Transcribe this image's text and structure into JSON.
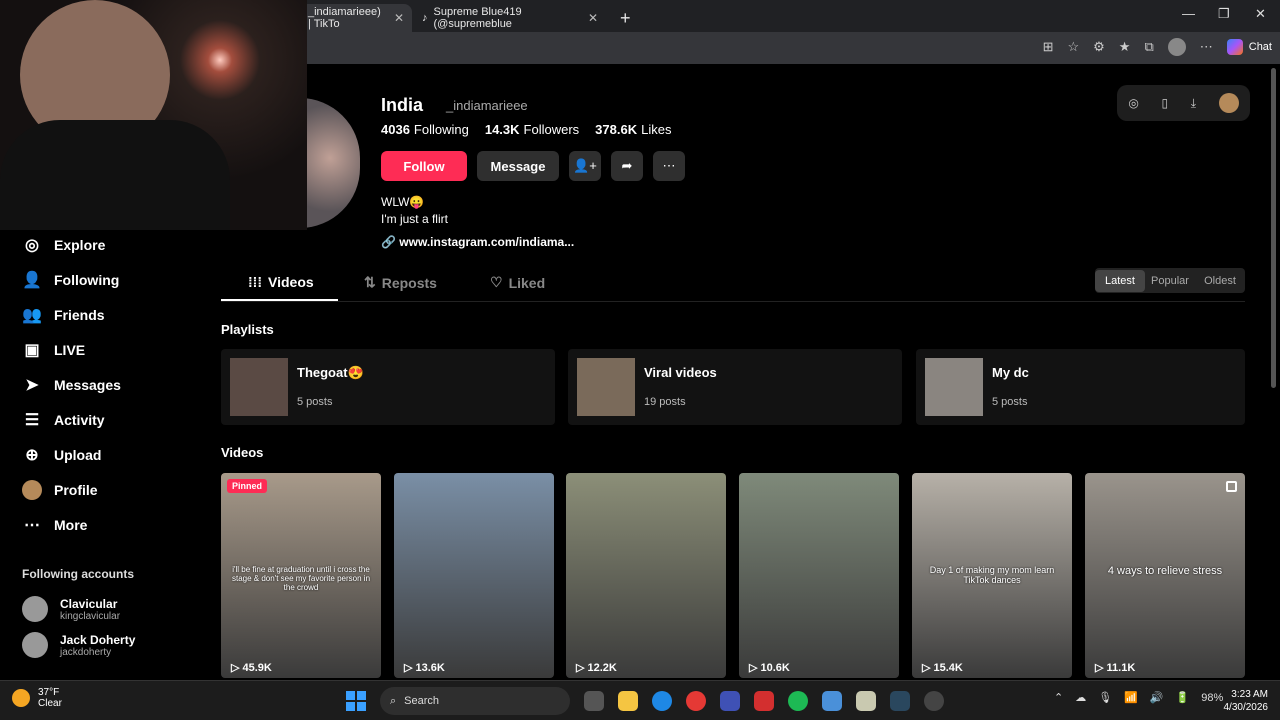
{
  "browser": {
    "tabs": [
      {
        "title": "_indiamarieee) | TikTo",
        "active": true
      },
      {
        "title": "Supreme Blue419 (@supremeblue",
        "active": false
      }
    ],
    "new_tab_icon": "plus-icon",
    "chat_label": "Chat"
  },
  "profile": {
    "name": "India",
    "handle": "_indiamarieee",
    "stats": [
      {
        "value": "4036",
        "label": "Following"
      },
      {
        "value": "14.3K",
        "label": "Followers"
      },
      {
        "value": "378.6K",
        "label": "Likes"
      }
    ],
    "follow_label": "Follow",
    "message_label": "Message",
    "bio_line1": "WLW😛",
    "bio_line2": "I'm just a flirt",
    "link": "www.instagram.com/indiama..."
  },
  "sidebar": {
    "items": [
      {
        "label": "Explore",
        "icon": "compass-icon"
      },
      {
        "label": "Following",
        "icon": "following-icon"
      },
      {
        "label": "Friends",
        "icon": "friends-icon"
      },
      {
        "label": "LIVE",
        "icon": "live-icon"
      },
      {
        "label": "Messages",
        "icon": "messages-icon"
      },
      {
        "label": "Activity",
        "icon": "activity-icon"
      },
      {
        "label": "Upload",
        "icon": "upload-icon"
      },
      {
        "label": "Profile",
        "icon": "profile-avatar"
      },
      {
        "label": "More",
        "icon": "more-icon"
      }
    ],
    "following_title": "Following accounts",
    "accounts": [
      {
        "name": "Clavicular",
        "handle": "kingclavicular"
      },
      {
        "name": "Jack Doherty",
        "handle": "jackdoherty"
      }
    ]
  },
  "content_tabs": [
    {
      "label": "Videos",
      "active": true
    },
    {
      "label": "Reposts",
      "active": false
    },
    {
      "label": "Liked",
      "active": false
    }
  ],
  "sort": [
    "Latest",
    "Popular",
    "Oldest"
  ],
  "playlists_title": "Playlists",
  "playlists": [
    {
      "title": "Thegoat😍",
      "count": "5 posts"
    },
    {
      "title": "Viral videos",
      "count": "19 posts"
    },
    {
      "title": "My dc",
      "count": "5 posts"
    }
  ],
  "videos_title": "Videos",
  "videos": [
    {
      "views": "45.9K",
      "pinned": "Pinned",
      "caption": "i'll be fine at graduation until i cross the stage & don't see my favorite person in the crowd",
      "color": "#a89a8a"
    },
    {
      "views": "13.6K",
      "caption": "",
      "color": "#7a8fa6"
    },
    {
      "views": "12.2K",
      "caption": "",
      "color": "#8c8f78"
    },
    {
      "views": "10.6K",
      "caption": "",
      "color": "#7f8a7a"
    },
    {
      "views": "15.4K",
      "caption": "Day 1 of making my mom learn TikTok dances",
      "color": "#b7b1a8"
    },
    {
      "views": "11.1K",
      "caption": "4 ways to relieve stress",
      "color": "#9a948c"
    }
  ],
  "taskbar": {
    "temp": "37°F",
    "weather": "Clear",
    "search": "Search",
    "battery": "98%",
    "time": "3:23 AM",
    "date": "4/30/2026"
  }
}
